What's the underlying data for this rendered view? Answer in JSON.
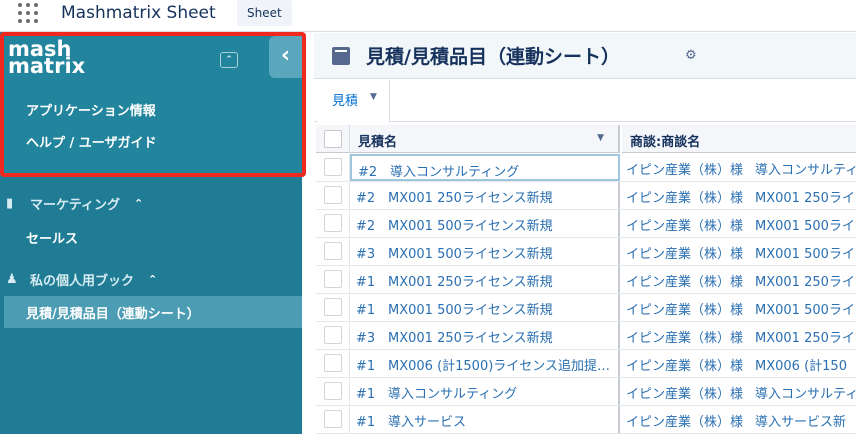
{
  "app": {
    "title": "Mashmatrix Sheet",
    "tab": "Sheet"
  },
  "sidebar": {
    "logo_line1": "mash",
    "logo_line2": "matrix",
    "links": [
      "アプリケーション情報",
      "ヘルプ / ユーザガイド"
    ],
    "groups": [
      {
        "label": "マーケティング",
        "icon": "folder-icon",
        "items": [
          "セールス"
        ]
      },
      {
        "label": "私の個人用ブック",
        "icon": "user-book-icon",
        "items": [
          "見積/見積品目（連動シート）"
        ]
      }
    ],
    "active_item": "見積/見積品目（連動シート）"
  },
  "main": {
    "title": "見積/見積品目（連動シート）",
    "subtab_label": "見積",
    "columns": [
      "見積名",
      "商談:商談名"
    ],
    "rows": [
      {
        "num": "#2",
        "name": "導入コンサルティング",
        "opp": "イピン産業（株）様",
        "opp_name": "導入コンサルティ"
      },
      {
        "num": "#2",
        "name": "MX001 250ライセンス新規",
        "opp": "イピン産業（株）様",
        "opp_name": "MX001 250ライ"
      },
      {
        "num": "#2",
        "name": "MX001 500ライセンス新規",
        "opp": "イピン産業（株）様",
        "opp_name": "MX001 500ライ"
      },
      {
        "num": "#3",
        "name": "MX001 500ライセンス新規",
        "opp": "イピン産業（株）様",
        "opp_name": "MX001 500ライ"
      },
      {
        "num": "#1",
        "name": "MX001 250ライセンス新規",
        "opp": "イピン産業（株）様",
        "opp_name": "MX001 250ライ"
      },
      {
        "num": "#1",
        "name": "MX001 500ライセンス新規",
        "opp": "イピン産業（株）様",
        "opp_name": "MX001 500ライ"
      },
      {
        "num": "#3",
        "name": "MX001 250ライセンス新規",
        "opp": "イピン産業（株）様",
        "opp_name": "MX001 250ライ"
      },
      {
        "num": "#1",
        "name": "MX006 (計1500)ライセンス追加提…",
        "opp": "イピン産業（株）様",
        "opp_name": "MX006 (計150"
      },
      {
        "num": "#1",
        "name": "導入コンサルティング",
        "opp": "イピン産業（株）様",
        "opp_name": "導入コンサルティ"
      },
      {
        "num": "#1",
        "name": "導入サービス",
        "opp": "イピン産業（株）様",
        "opp_name": "導入サービス新"
      }
    ]
  },
  "colors": {
    "sidebar_bg": "#1f7c94",
    "brand_panel_bg": "#23859d",
    "highlight_border": "#f0281e",
    "link_blue": "#2a6fb2"
  }
}
